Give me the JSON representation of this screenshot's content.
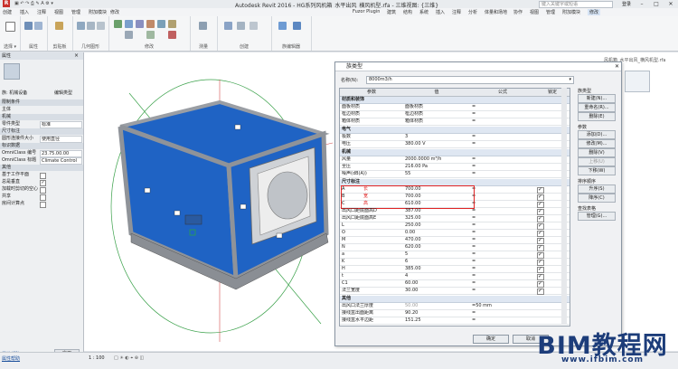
{
  "app": {
    "title": "Autodesk Revit 2016 -    HG系列风机箱_水平出风_横风机型.rfa - 三维视图: {三维}",
    "search_placeholder": "键入关键字或短语",
    "user": "登录"
  },
  "menubar": {
    "items": [
      "创建",
      "插入",
      "注释",
      "视图",
      "管理",
      "附加模块",
      "修改",
      "Fuzor Plugin",
      "建筑",
      "结构",
      "系统",
      "插入",
      "注释",
      "分析",
      "体量和场地",
      "协作",
      "视图",
      "管理",
      "附加模块",
      "修改"
    ]
  },
  "ribbon": {
    "groups": [
      "选择",
      "属性",
      "剪贴板",
      "几何图形",
      "修改",
      "测量",
      "创建",
      "族编辑器"
    ],
    "select_label": "选择 ▾"
  },
  "properties": {
    "header": "属性",
    "type_name": "族: 机械设备",
    "edit_type": "编辑类型",
    "sections": [
      {
        "label": "限制条件",
        "rows": [
          {
            "k": "主体",
            "v": ""
          }
        ]
      },
      {
        "label": "机械",
        "rows": [
          {
            "k": "零件类型",
            "v": "标准"
          }
        ]
      },
      {
        "label": "尺寸标注",
        "rows": [
          {
            "k": "圆形连接件大小",
            "v": "使用直径"
          }
        ]
      },
      {
        "label": "标识数据",
        "rows": [
          {
            "k": "OmniClass 编号",
            "v": "23.75.00.00"
          },
          {
            "k": "OmniClass 标题",
            "v": "Climate Control"
          }
        ]
      },
      {
        "label": "其他",
        "rows": [
          {
            "k": "基于工作平面",
            "v": ""
          },
          {
            "k": "总是垂直",
            "v": "✓"
          },
          {
            "k": "加载时剪切的空心",
            "v": ""
          },
          {
            "k": "共享",
            "v": ""
          },
          {
            "k": "房间计算点",
            "v": ""
          }
        ]
      }
    ],
    "help_link": "属性帮助",
    "apply": "应用"
  },
  "dialog": {
    "title": "族类型",
    "name_label": "名称(N):",
    "name_value": "8000m3/h",
    "columns": [
      "参数",
      "值",
      "公式",
      "锁定"
    ],
    "sections": [
      {
        "label": "材质和装饰",
        "rows": [
          {
            "p": "面板材质",
            "v": "面板材质",
            "f": "=",
            "lock": false
          },
          {
            "p": "框边材质",
            "v": "框边材质",
            "f": "=",
            "lock": false
          },
          {
            "p": "箱体材质",
            "v": "箱体材质",
            "f": "=",
            "lock": false
          }
        ]
      },
      {
        "label": "电气",
        "rows": [
          {
            "p": "极数",
            "v": "3",
            "f": "=",
            "lock": false
          },
          {
            "p": "电压",
            "v": "380.00 V",
            "f": "=",
            "lock": false
          }
        ]
      },
      {
        "label": "机械",
        "rows": [
          {
            "p": "风量",
            "v": "2000.0000 m³/h",
            "f": "=",
            "lock": false
          },
          {
            "p": "全压",
            "v": "216.00 Pa",
            "f": "=",
            "lock": false
          },
          {
            "p": "噪声(dB(A))",
            "v": "55",
            "f": "=",
            "lock": false
          }
        ]
      },
      {
        "label": "尺寸标注",
        "rows": [
          {
            "p": "A",
            "note": "长",
            "v": "700.00",
            "f": "=",
            "lock": true
          },
          {
            "p": "B",
            "note": "宽",
            "v": "700.00",
            "f": "=",
            "lock": true
          },
          {
            "p": "C",
            "note": "高",
            "v": "610.00",
            "f": "=",
            "lock": true
          },
          {
            "p": "出风口距底面高D",
            "v": "387.00",
            "f": "=",
            "lock": true
          },
          {
            "p": "出风口距底面高E",
            "v": "325.00",
            "f": "=",
            "lock": true
          },
          {
            "p": "L",
            "v": "250.00",
            "f": "=",
            "lock": true
          },
          {
            "p": "O",
            "v": "0.00",
            "f": "=",
            "lock": true
          },
          {
            "p": "M",
            "v": "470.00",
            "f": "=",
            "lock": true
          },
          {
            "p": "N",
            "v": "620.00",
            "f": "=",
            "lock": true
          },
          {
            "p": "a",
            "v": "5",
            "f": "=",
            "lock": true
          },
          {
            "p": "K",
            "v": "6",
            "f": "=",
            "lock": true
          },
          {
            "p": "H",
            "v": "385.00",
            "f": "=",
            "lock": true
          },
          {
            "p": "t",
            "v": "4",
            "f": "=",
            "lock": true
          },
          {
            "p": "C1",
            "v": "60.00",
            "f": "=",
            "lock": true
          },
          {
            "p": "法兰宽度",
            "v": "30.00",
            "f": "=",
            "lock": true
          }
        ]
      },
      {
        "label": "其他",
        "rows": [
          {
            "p": "出风口法兰厚度",
            "v": "50.00",
            "f": "=50 mm",
            "lock": false,
            "dim": true
          },
          {
            "p": "接线盒出面距离",
            "v": "90.20",
            "f": "=",
            "lock": false
          },
          {
            "p": "接线盒水平边距",
            "v": "151.25",
            "f": "=",
            "lock": false
          },
          {
            "p": "出风口法兰宽度",
            "v": "70.00",
            "f": "=70 mm",
            "lock": false,
            "dim": true
          }
        ]
      }
    ],
    "right": {
      "type_group": "族类型",
      "type_buttons": [
        "新建(N)...",
        "重命名(R)...",
        "删除(E)"
      ],
      "param_group": "参数",
      "param_buttons": [
        "添加(D)...",
        "修改(M)...",
        "删除(V)",
        "上移(U)",
        "下移(W)"
      ],
      "sort_group": "排序顺序",
      "sort_buttons": [
        "升序(S)",
        "降序(C)"
      ],
      "lookup_group": "查找表格",
      "lookup_button": "管理(G)..."
    },
    "ok": "确定",
    "cancel": "取消"
  },
  "viewport": {
    "tab_title": "风机箱_水平出风_横风机型.rfa"
  },
  "status": {
    "scale": "1 : 100",
    "ready": "单击可进行选择; 按 Tab 键单击可选择其他项目"
  },
  "watermark": {
    "brand": "BIM教程网",
    "url": "www.ifbim.com"
  },
  "colors": {
    "panel_blue": "#1f63c4",
    "frame_gray": "#8f9399",
    "highlight_red": "#e02424"
  }
}
